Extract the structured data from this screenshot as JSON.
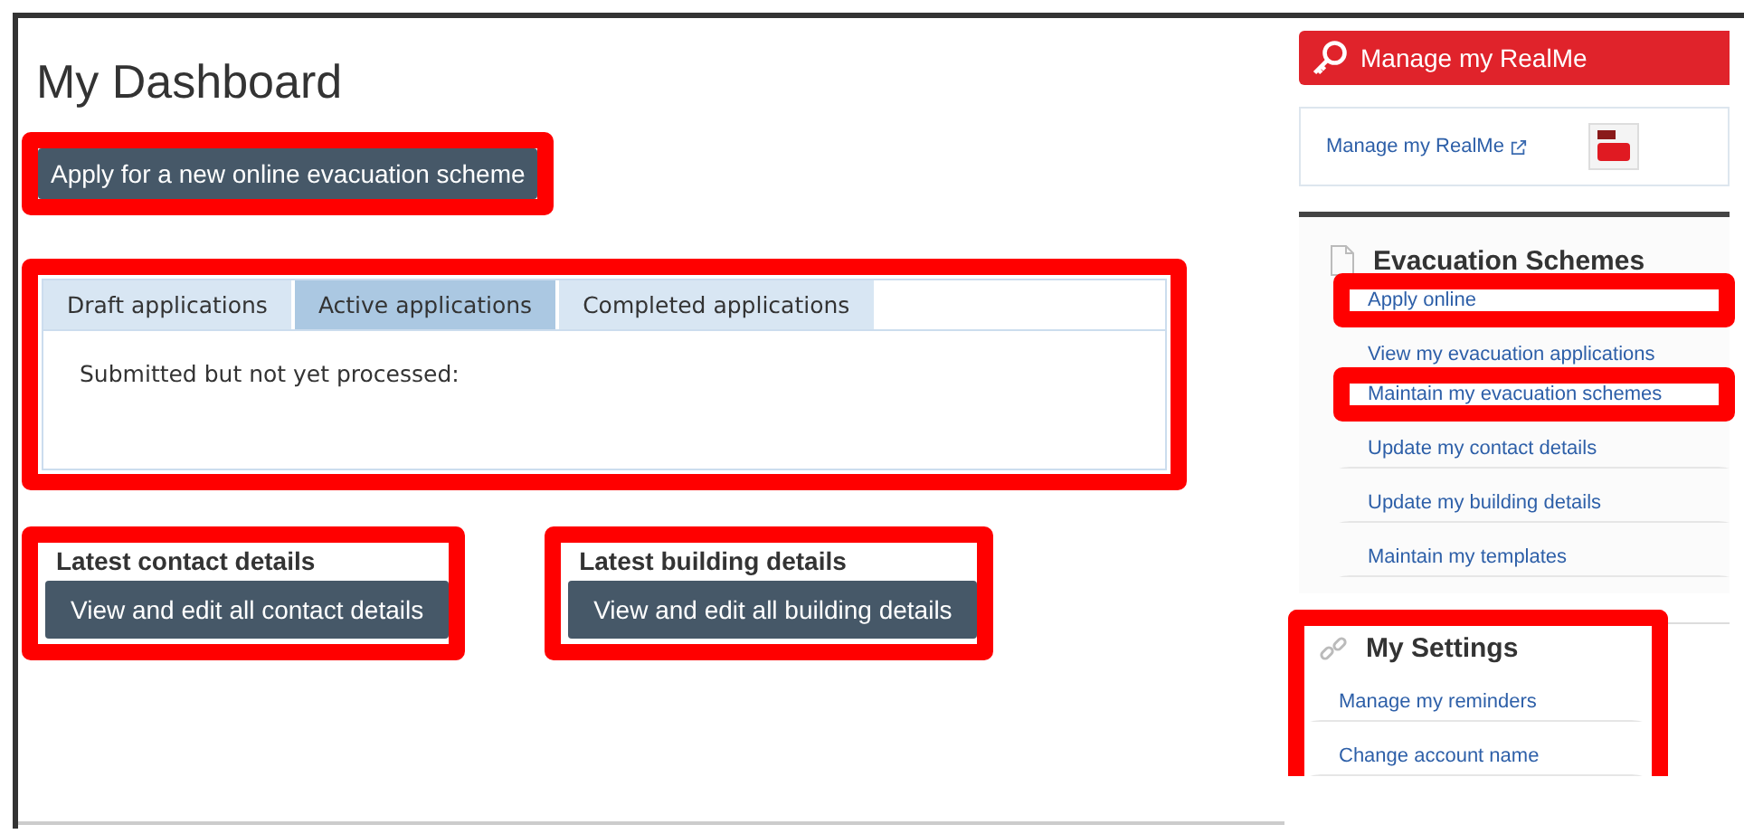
{
  "page": {
    "title": "My Dashboard"
  },
  "apply_button": {
    "label": "Apply for a new online evacuation scheme",
    "highlighted": true
  },
  "applications": {
    "highlighted": true,
    "tabs": [
      {
        "label": "Draft applications",
        "selected": false
      },
      {
        "label": "Active applications",
        "selected": true
      },
      {
        "label": "Completed applications",
        "selected": false
      }
    ],
    "content": "Submitted but not yet processed:"
  },
  "details_panels": [
    {
      "heading": "Latest contact details",
      "button": "View and edit all contact details",
      "highlighted": true
    },
    {
      "heading": "Latest building details",
      "button": "View and edit all building details",
      "highlighted": true
    }
  ],
  "sidebar": {
    "realme": {
      "header": "Manage my RealMe",
      "link": "Manage my RealMe"
    },
    "sections": [
      {
        "kind": "schemes",
        "heading": "Evacuation Schemes",
        "highlighted": false,
        "links": [
          {
            "label": "Apply online",
            "highlighted": true
          },
          {
            "label": "View my evacuation applications",
            "highlighted": false
          },
          {
            "label": "Maintain my evacuation schemes",
            "highlighted": true
          },
          {
            "label": "Update my contact details",
            "highlighted": false
          },
          {
            "label": "Update my building details",
            "highlighted": false
          },
          {
            "label": "Maintain my templates",
            "highlighted": false
          }
        ]
      },
      {
        "kind": "settings",
        "heading": "My Settings",
        "highlighted": true,
        "links": [
          {
            "label": "Manage my reminders",
            "highlighted": false
          },
          {
            "label": "Change account name",
            "highlighted": false
          }
        ]
      }
    ]
  }
}
